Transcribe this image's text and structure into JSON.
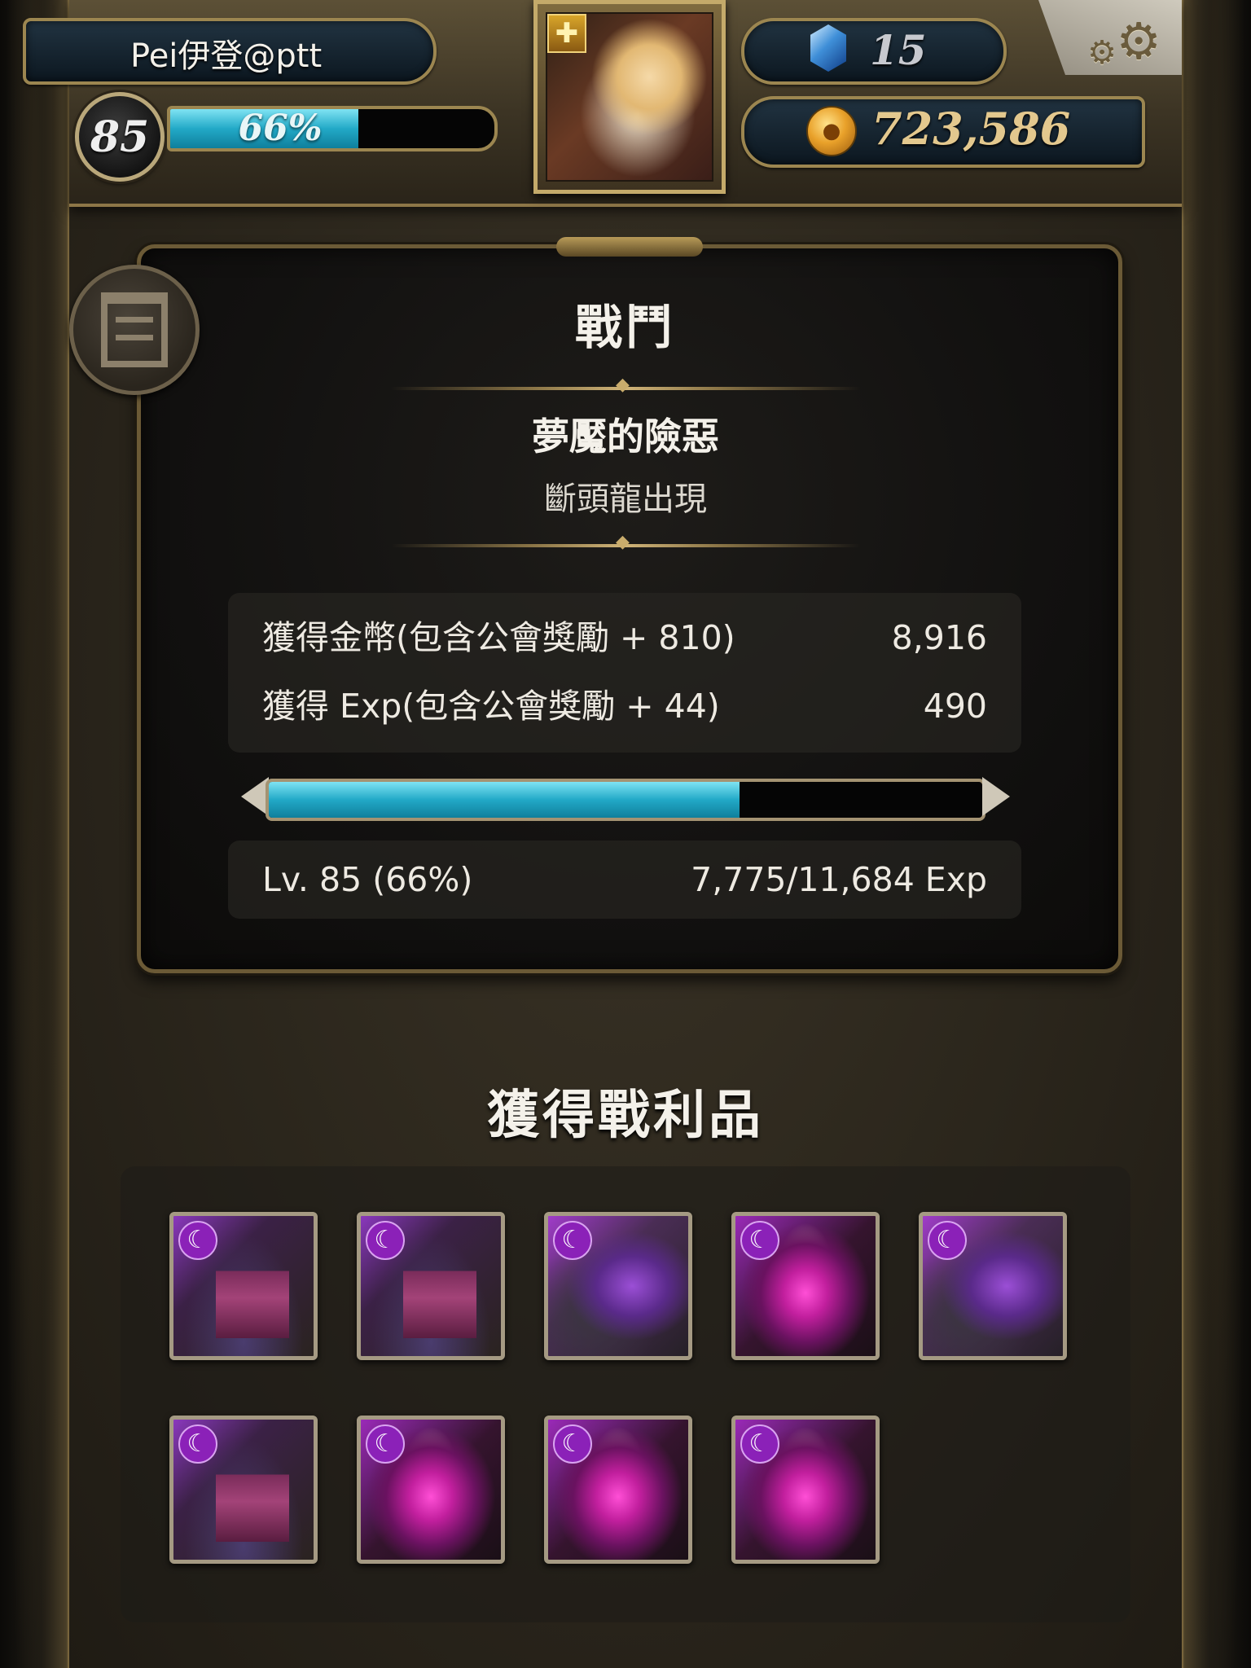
{
  "header": {
    "player_name": "Pei伊登@ptt",
    "level": "85",
    "exp_percent_text": "66%",
    "exp_fraction": 0.66,
    "gems": "15",
    "gold": "723,586"
  },
  "battle": {
    "title": "戰鬥",
    "stage_name": "夢魘的險惡",
    "stage_subtitle": "斷頭龍出現",
    "rewards": [
      {
        "label": "獲得金幣(包含公會獎勵 + 810)",
        "value": "8,916"
      },
      {
        "label": "獲得 Exp(包含公會獎勵 + 44)",
        "value": "490"
      }
    ],
    "level_text": "Lv. 85 (66%)",
    "exp_text": "7,775/11,684 Exp",
    "exp_fraction": 0.66
  },
  "loot": {
    "title": "獲得戰利品",
    "items": [
      {
        "kind": "tower",
        "icon": "moon-icon"
      },
      {
        "kind": "tower",
        "icon": "moon-icon"
      },
      {
        "kind": "dragon",
        "icon": "moon-icon"
      },
      {
        "kind": "demon",
        "icon": "moon-icon"
      },
      {
        "kind": "dragon",
        "icon": "moon-icon"
      },
      {
        "kind": "tower",
        "icon": "moon-icon"
      },
      {
        "kind": "demon",
        "icon": "moon-icon"
      },
      {
        "kind": "demon",
        "icon": "moon-icon"
      },
      {
        "kind": "demon",
        "icon": "moon-icon"
      }
    ]
  },
  "colors": {
    "exp_bar": "#22a9c7",
    "frame_gold": "#9c8650",
    "loot_purple": "#8b21b8"
  }
}
